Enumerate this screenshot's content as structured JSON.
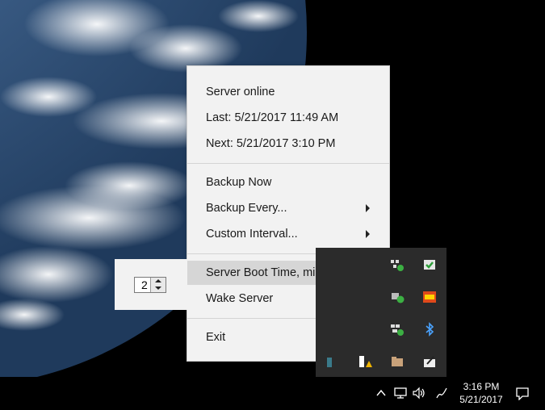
{
  "menu": {
    "status": "Server online",
    "last": "Last:  5/21/2017 11:49 AM",
    "next": "Next: 5/21/2017 3:10 PM",
    "backup_now": "Backup Now",
    "backup_every": "Backup Every...",
    "custom_interval": "Custom Interval...",
    "boot_time": "Server Boot Time, minutes...",
    "wake_server": "Wake Server",
    "exit": "Exit"
  },
  "stepper": {
    "value": "2"
  },
  "taskbar": {
    "time": "3:16 PM",
    "date": "5/21/2017"
  },
  "colors": {
    "menu_bg": "#f2f2f2",
    "highlight": "#d6d6d6",
    "tray_bg": "#2b2b2b"
  }
}
